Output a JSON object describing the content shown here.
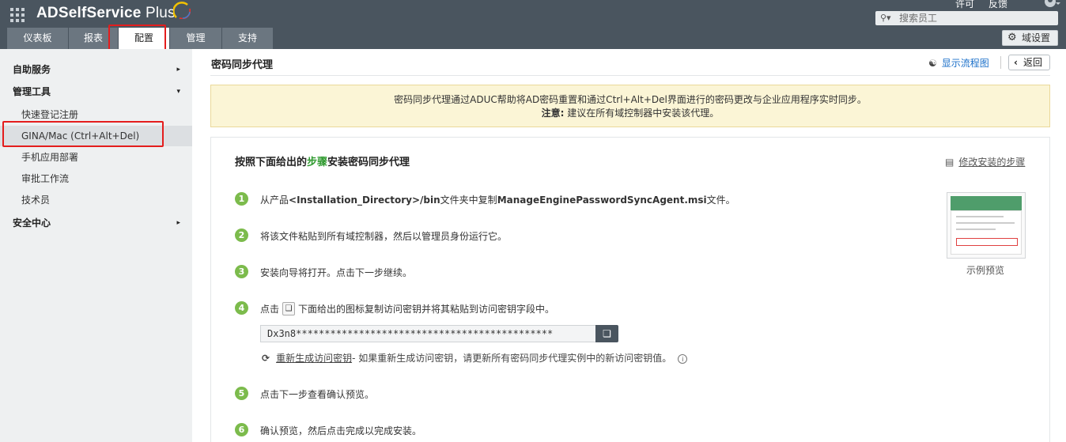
{
  "header": {
    "app_name": "ADSelfService",
    "app_name_plus": " Plus",
    "top_links": [
      "许可",
      "反馈"
    ],
    "search_placeholder": "搜索员工",
    "domain_settings_label": "域设置",
    "icons": {
      "apps": "apps-grid-icon",
      "search": "search-icon",
      "user": "user-icon",
      "gear": "gear-icon"
    }
  },
  "tabs": [
    {
      "label": "仪表板",
      "active": false
    },
    {
      "label": "报表",
      "active": false
    },
    {
      "label": "配置",
      "active": true
    },
    {
      "label": "管理",
      "active": false
    },
    {
      "label": "支持",
      "active": false
    }
  ],
  "sidebar": {
    "items": [
      {
        "label": "自助服务",
        "type": "section",
        "arrow": "▸"
      },
      {
        "label": "管理工具",
        "type": "section",
        "arrow": "▾"
      },
      {
        "label": "快速登记注册",
        "type": "sub"
      },
      {
        "label": "GINA/Mac (Ctrl+Alt+Del)",
        "type": "sub",
        "selected": true
      },
      {
        "label": "手机应用部署",
        "type": "sub"
      },
      {
        "label": "审批工作流",
        "type": "sub"
      },
      {
        "label": "技术员",
        "type": "sub"
      },
      {
        "label": "安全中心",
        "type": "section",
        "arrow": "▸"
      }
    ]
  },
  "page": {
    "title": "密码同步代理",
    "flow_link": "显示流程图",
    "back_label": "返回",
    "notice_line1": "密码同步代理通过ADUC帮助将AD密码重置和通过Ctrl+Alt+Del界面进行的密码更改与企业应用程序实时同步。",
    "notice_note_label": "注意:",
    "notice_note_text": " 建议在所有域控制器中安装该代理。"
  },
  "panel": {
    "title_pre": "按照下面给出的",
    "title_green": "步骤",
    "title_post": "安装密码同步代理",
    "modify_link": "修改安装的步骤",
    "preview_caption": "示例预览",
    "steps": [
      {
        "num": "1",
        "pre": "从产品",
        "bold1": "<Installation_Directory>/bin",
        "mid": "文件夹中复制",
        "bold2": "ManageEnginePasswordSyncAgent.msi",
        "post": "文件。"
      },
      {
        "num": "2",
        "text": "将该文件粘贴到所有域控制器，然后以管理员身份运行它。"
      },
      {
        "num": "3",
        "text": "安装向导将打开。点击下一步继续。"
      },
      {
        "num": "4",
        "pre": "点击",
        "post": "下面给出的图标复制访问密钥并将其粘贴到访问密钥字段中。"
      },
      {
        "num": "5",
        "text": "点击下一步查看确认预览。"
      },
      {
        "num": "6",
        "text": "确认预览，然后点击完成以完成安装。"
      }
    ],
    "access_key": "Dx3n8*********************************************",
    "regen_link": "重新生成访问密钥",
    "regen_text": "- 如果重新生成访问密钥，请更新所有密码同步代理实例中的新访问密钥值。"
  }
}
